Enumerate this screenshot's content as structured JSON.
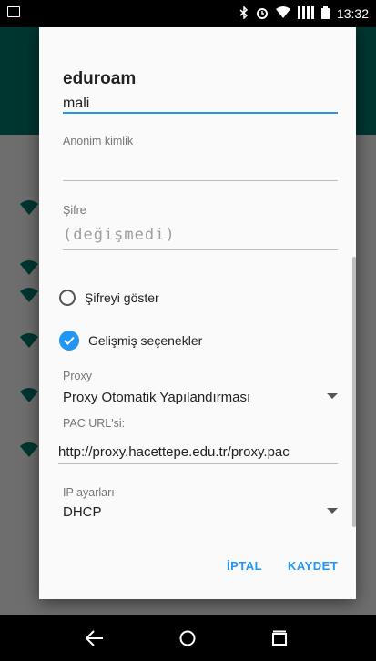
{
  "status_bar": {
    "time": "13:32",
    "icons": [
      "image-icon",
      "bluetooth-icon",
      "alarm-icon",
      "wifi-icon",
      "signal-icon",
      "battery-icon"
    ]
  },
  "dialog": {
    "title": "eduroam",
    "identity_value": "mali",
    "anonymous_identity_label": "Anonim kimlik",
    "anonymous_identity_value": "",
    "password_label": "Şifre",
    "password_placeholder": "(değişmedi)",
    "show_password_label": "Şifreyi göster",
    "show_password_checked": false,
    "advanced_options_label": "Gelişmiş seçenekler",
    "advanced_options_checked": true,
    "proxy_label": "Proxy",
    "proxy_value": "Proxy Otomatik Yapılandırması",
    "pac_url_label": "PAC URL'si:",
    "pac_url_value": "http://proxy.hacettepe.edu.tr/proxy.pac",
    "ip_settings_label": "IP ayarları",
    "ip_settings_value": "DHCP",
    "cancel_label": "İPTAL",
    "save_label": "KAYDET"
  },
  "colors": {
    "accent": "#2196f3",
    "toolbar": "#00796b"
  },
  "nav_bar": {
    "icons": [
      "back-icon",
      "home-icon",
      "recents-icon"
    ]
  }
}
